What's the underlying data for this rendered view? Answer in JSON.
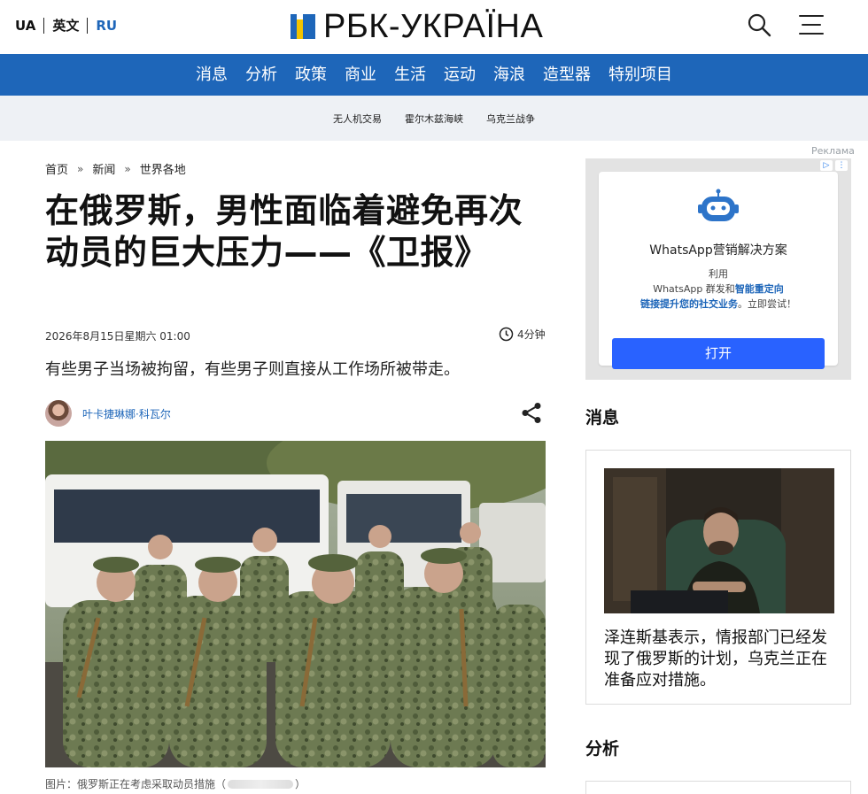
{
  "header": {
    "languages": [
      "UA",
      "英文",
      "RU"
    ],
    "active_language": "RU",
    "logo_text": "РБК-УКРАЇНА",
    "search_icon": "search-icon",
    "menu_icon": "hamburger-menu-icon"
  },
  "nav": {
    "items": [
      "消息",
      "分析",
      "政策",
      "商业",
      "生活",
      "运动",
      "海浪",
      "造型器",
      "特别项目"
    ]
  },
  "tags": [
    "无人机交易",
    "霍尔木兹海峡",
    "乌克兰战争"
  ],
  "breadcrumb": [
    "首页",
    "新闻",
    "世界各地"
  ],
  "breadcrumb_separator": "»",
  "article": {
    "headline": "在俄罗斯，男性面临着避免再次动员的巨大压力——《卫报》",
    "date": "2026年8月15日星期六 01:00",
    "read_time": "4分钟",
    "lead": "有些男子当场被拘留，有些男子则直接从工作场所被带走。",
    "author": "叶卡捷琳娜·科瓦尔",
    "caption_prefix": "图片：俄罗斯正在考虑采取动员措施（",
    "caption_suffix": "）"
  },
  "ad": {
    "label": "Реклама",
    "title": "WhatsApp营销解决方案",
    "desc_line1": "利用",
    "desc_line2_plain": "WhatsApp 群发和",
    "desc_line2_hl": "智能重定向",
    "desc_line3_hl": "链接提升您的社交业务",
    "desc_line3_plain": "。立即尝试！",
    "cta": "打开",
    "colors": {
      "cta": "#2962ff",
      "bot": "#2d74c9"
    }
  },
  "sidebar": {
    "news_heading": "消息",
    "news_title": "泽连斯基表示，情报部门已经发现了俄罗斯的计划，乌克兰正在准备应对措施。",
    "analysis_heading": "分析"
  },
  "colors": {
    "brand_blue": "#1e66b9",
    "tag_bg": "#eef1f5",
    "logo_blue": "#1e66b9",
    "logo_yellow": "#f2c300"
  }
}
